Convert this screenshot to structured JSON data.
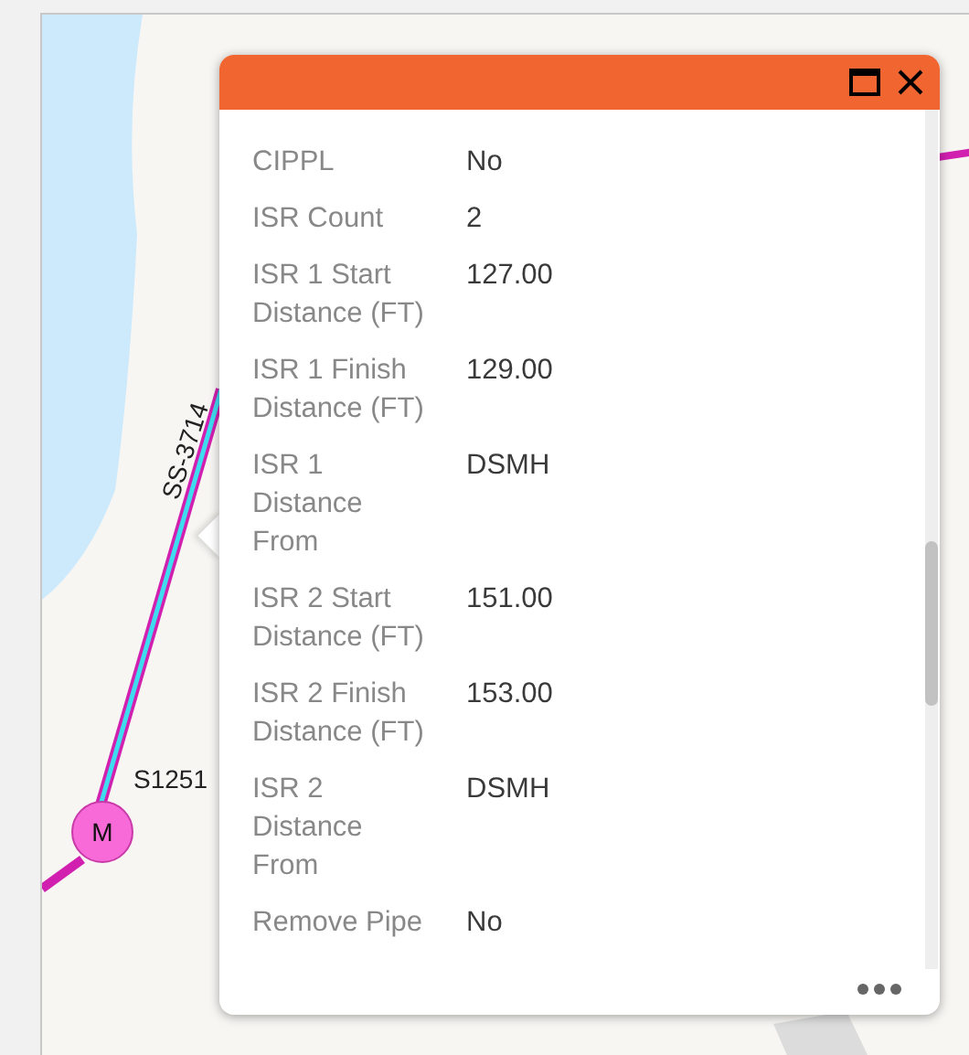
{
  "map": {
    "labels": [
      {
        "kind": "pipe",
        "text": "SS-3714"
      },
      {
        "kind": "node",
        "text": "S1251"
      },
      {
        "kind": "marker",
        "text": "M"
      }
    ]
  },
  "popup": {
    "fields": [
      {
        "label": "CIPPL",
        "value": "No"
      },
      {
        "label": "ISR Count",
        "value": "2"
      },
      {
        "label": "ISR 1 Start Distance (FT)",
        "value": "127.00"
      },
      {
        "label": "ISR 1 Finish Distance (FT)",
        "value": "129.00"
      },
      {
        "label": "ISR 1 Distance From",
        "value": "DSMH"
      },
      {
        "label": "ISR 2 Start Distance (FT)",
        "value": "151.00"
      },
      {
        "label": "ISR 2 Finish Distance (FT)",
        "value": "153.00"
      },
      {
        "label": "ISR 2 Distance From",
        "value": "DSMH"
      },
      {
        "label": "Remove Pipe",
        "value": "No"
      }
    ]
  }
}
